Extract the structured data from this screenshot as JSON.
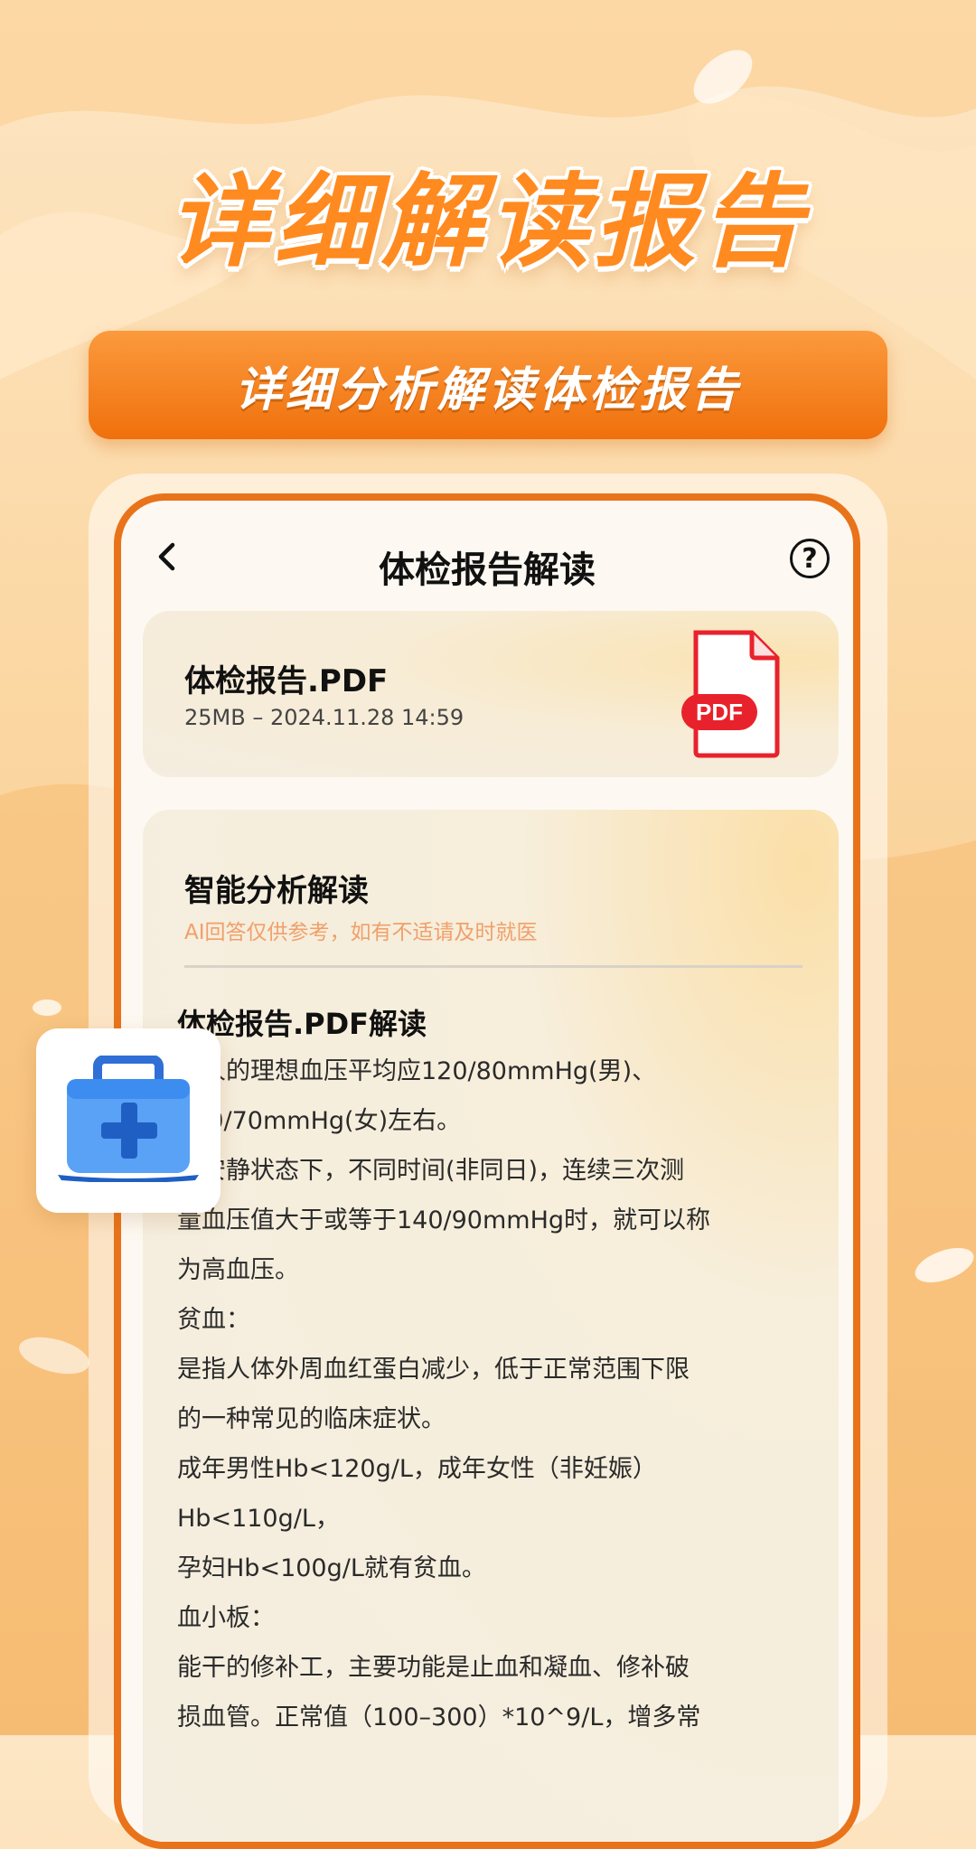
{
  "hero": {
    "title": "详细解读报告",
    "subtitle": "详细分析解读体检报告"
  },
  "nav": {
    "title": "体检报告解读",
    "back_icon": "chevron-left-icon",
    "help_icon": "question-circle-icon",
    "help_glyph": "?"
  },
  "file_card": {
    "name": "体检报告.PDF",
    "meta": "25MB – 2024.11.28 14:59",
    "icon_label": "PDF",
    "icon": "pdf-file-icon"
  },
  "analysis": {
    "title": "智能分析解读",
    "note": "AI回答仅供参考，如有不适请及时就医",
    "report_title": "体检报告.PDF解读",
    "lines": [
      "成人的理想血压平均应120/80mmHg(男)、",
      "110/70mmHg(女)左右。",
      "在安静状态下，不同时间(非同日)，连续三次测",
      "量血压值大于或等于140/90mmHg时，就可以称",
      "为高血压。",
      "贫血：",
      "是指人体外周血红蛋白减少，低于正常范围下限",
      "的一种常见的临床症状。",
      "成年男性Hb<120g/L，成年女性（非妊娠）",
      "Hb<110g/L，",
      "孕妇Hb<100g/L就有贫血。",
      "血小板：",
      "能干的修补工，主要功能是止血和凝血、修补破",
      "损血管。正常值（100–300）*10^9/L，增多常"
    ]
  },
  "decor": {
    "kit_icon": "medical-kit-icon"
  },
  "colors": {
    "accent": "#f0700c",
    "title_orange": "#ff8a1f",
    "pdf_red": "#e8222c",
    "kit_blue": "#3d8cf0"
  }
}
